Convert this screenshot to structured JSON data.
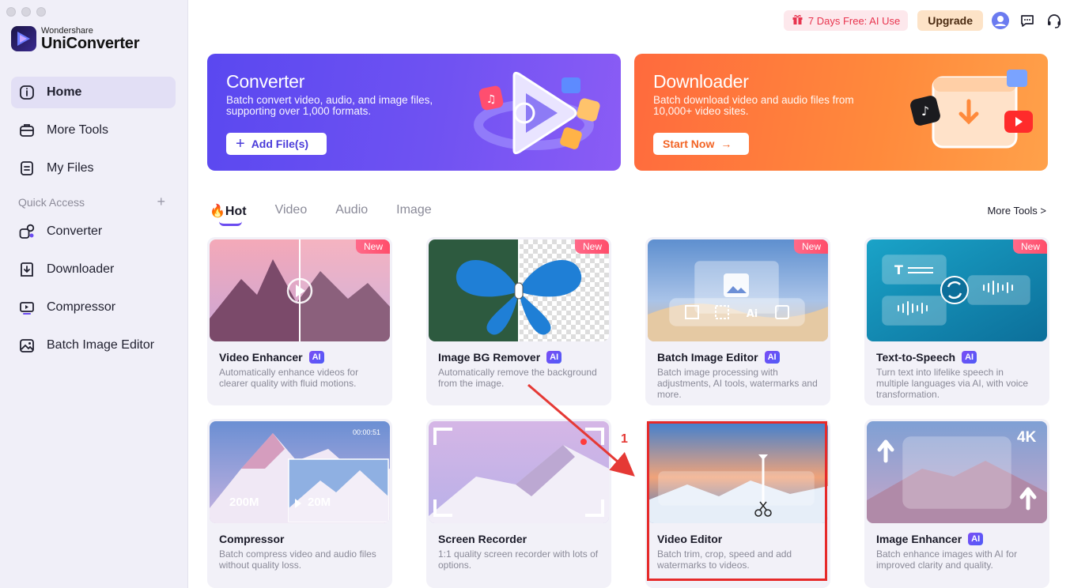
{
  "app": {
    "brand_top": "Wondershare",
    "brand_main": "UniConverter"
  },
  "sidebar": {
    "nav": [
      {
        "label": "Home",
        "icon": "home-icon",
        "active": true
      },
      {
        "label": "More Tools",
        "icon": "toolbox-icon"
      },
      {
        "label": "My Files",
        "icon": "file-icon"
      }
    ],
    "quick_access_title": "Quick Access",
    "quick_access": [
      {
        "label": "Converter",
        "icon": "converter-icon"
      },
      {
        "label": "Downloader",
        "icon": "downloader-icon"
      },
      {
        "label": "Compressor",
        "icon": "compressor-icon"
      },
      {
        "label": "Batch Image Editor",
        "icon": "image-editor-icon"
      }
    ]
  },
  "topbar": {
    "promo": "7 Days Free: AI Use",
    "upgrade": "Upgrade"
  },
  "banners": {
    "converter": {
      "title": "Converter",
      "desc": "Batch convert video, audio, and image files, supporting over 1,000 formats.",
      "cta": "Add File(s)"
    },
    "downloader": {
      "title": "Downloader",
      "desc": "Batch download video and audio files from 10,000+ video sites.",
      "cta": "Start Now"
    }
  },
  "tabs": [
    "Hot",
    "Video",
    "Audio",
    "Image"
  ],
  "more_tools": "More Tools >",
  "new_label": "New",
  "ai_label": "AI",
  "cards": [
    {
      "title": "Video Enhancer",
      "desc": "Automatically enhance videos for clearer quality with fluid motions.",
      "ai": true,
      "new": true
    },
    {
      "title": "Image BG Remover",
      "desc": "Automatically remove the background from the image.",
      "ai": true,
      "new": true
    },
    {
      "title": "Batch Image Editor",
      "desc": "Batch image processing with adjustments, AI tools, watermarks and more.",
      "ai": true,
      "new": true
    },
    {
      "title": "Text-to-Speech",
      "desc": "Turn text into lifelike speech in multiple languages via AI, with voice transformation.",
      "ai": true,
      "new": true
    },
    {
      "title": "Compressor",
      "desc": "Batch compress video and audio files without quality loss.",
      "ai": false,
      "new": false,
      "size_from": "200M",
      "size_to": "20M",
      "timecode": "00:00:51"
    },
    {
      "title": "Screen Recorder",
      "desc": "1:1 quality screen recorder with lots of options.",
      "ai": false,
      "new": false
    },
    {
      "title": "Video Editor",
      "desc": "Batch trim, crop, speed and add watermarks to videos.",
      "ai": false,
      "new": false
    },
    {
      "title": "Image Enhancer",
      "desc": "Batch enhance images with AI for improved clarity and quality.",
      "ai": true,
      "new": false,
      "resolution": "4K"
    }
  ],
  "annotation": {
    "number": "1",
    "color": "#e53935"
  },
  "colors": {
    "accent": "#6b4cf0",
    "converter_banner": "#5a48f0",
    "downloader_banner": "#ff7a3c",
    "promo": "#e8344e"
  }
}
